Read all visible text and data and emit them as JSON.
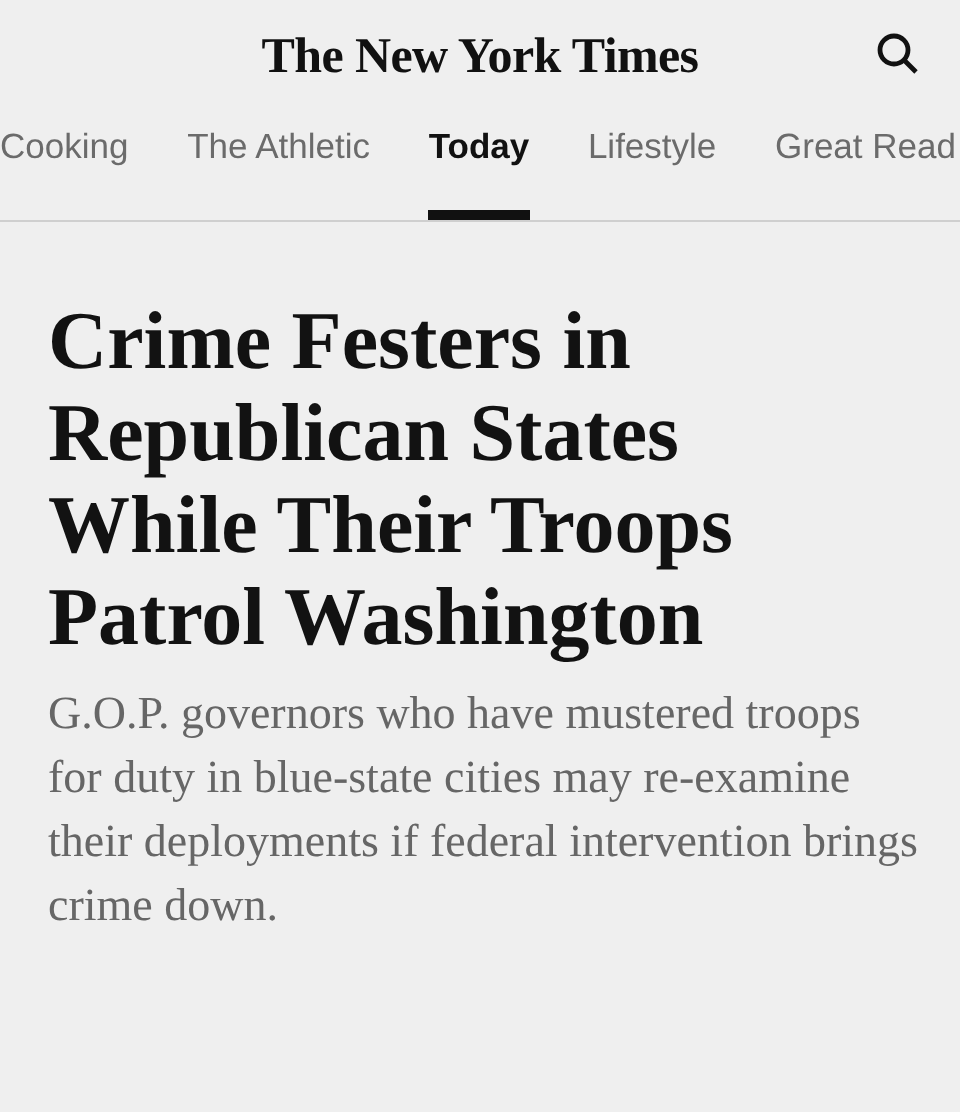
{
  "masthead": {
    "title": "The New York Times"
  },
  "tabs": [
    {
      "label": "Cooking",
      "selected": false
    },
    {
      "label": "The Athletic",
      "selected": false
    },
    {
      "label": "Today",
      "selected": true
    },
    {
      "label": "Lifestyle",
      "selected": false
    },
    {
      "label": "Great Read",
      "selected": false
    }
  ],
  "article": {
    "headline": "Crime Festers in Republican States While Their Troops Patrol Washington",
    "summary": "G.O.P. governors who have mustered troops for duty in blue-state cities may re-examine their deployments if federal intervention brings crime down."
  }
}
